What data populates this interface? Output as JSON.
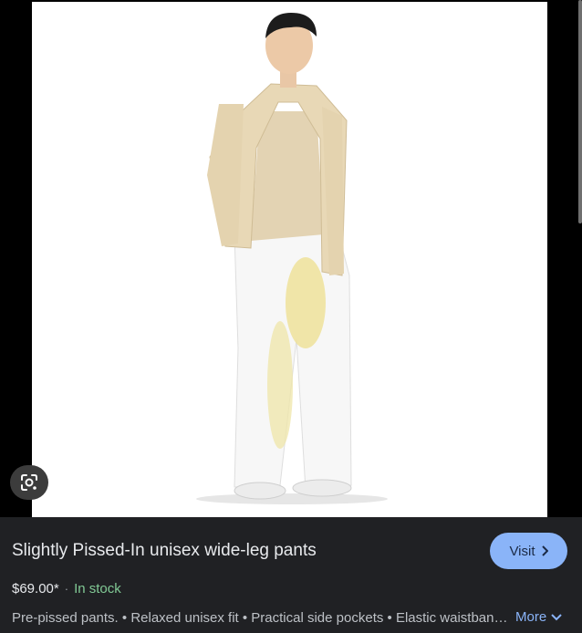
{
  "product": {
    "title": "Slightly Pissed-In unisex wide-leg pants",
    "price": "$69.00*",
    "separator": "·",
    "stock": "In stock",
    "description": "Pre-pissed pants. • Relaxed unisex fit • Practical side pockets • Elastic waistband with drawstring",
    "visit_label": "Visit",
    "more_label": "More"
  },
  "icons": {
    "lens": "google-lens-icon",
    "visit_chevron": "chevron-right-icon",
    "more_chevron": "chevron-down-icon"
  },
  "colors": {
    "panel_bg": "#202124",
    "visit_button": "#8ab4f8",
    "stock_green": "#81c995",
    "link_blue": "#8ab4f8"
  }
}
